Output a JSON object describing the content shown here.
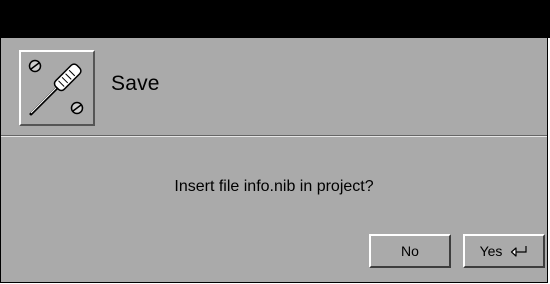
{
  "dialog": {
    "title": "Save",
    "icon": "screwdriver-icon",
    "message": "Insert file info.nib in project?"
  },
  "buttons": {
    "no_label": "No",
    "yes_label": "Yes",
    "yes_shortcut_icon": "return-key-icon"
  },
  "colors": {
    "panel": "#aaaaaa",
    "titlebar": "#000000",
    "text": "#000000"
  }
}
